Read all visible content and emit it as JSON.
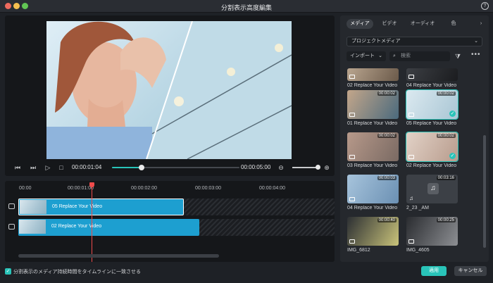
{
  "window": {
    "title": "分割表示高度編集"
  },
  "player": {
    "current_time": "00:00:01:04",
    "duration": "00:00:05:00",
    "progress": 0.23
  },
  "timeline": {
    "ticks": [
      "00:00",
      "00:00:01:00",
      "00:00:02:00",
      "00:00:03:00",
      "00:00:04:00"
    ],
    "clips": [
      {
        "label": "05 Replace Your Video",
        "selected": true
      },
      {
        "label": "02 Replace Your Video",
        "selected": false
      }
    ]
  },
  "media": {
    "tabs": [
      {
        "label": "メディア",
        "active": true
      },
      {
        "label": "ビデオ",
        "active": false
      },
      {
        "label": "オーディオ",
        "active": false
      },
      {
        "label": "色",
        "active": false
      }
    ],
    "source_select": "プロジェクトメディア",
    "import_label": "インポート",
    "search_placeholder": "検索",
    "items": [
      {
        "name": "02 Replace Your Video",
        "duration": "",
        "selected": false,
        "kind": "video"
      },
      {
        "name": "04 Replace Your Video",
        "duration": "",
        "selected": false,
        "kind": "video"
      },
      {
        "name": "01 Replace Your Video",
        "duration": "00:00:02",
        "selected": false,
        "kind": "video"
      },
      {
        "name": "05 Replace Your Video",
        "duration": "00:00:02",
        "selected": true,
        "kind": "video"
      },
      {
        "name": "03 Replace Your Video",
        "duration": "00:00:02",
        "selected": false,
        "kind": "video"
      },
      {
        "name": "02 Replace Your Video",
        "duration": "00:00:02",
        "selected": true,
        "kind": "video"
      },
      {
        "name": "04 Replace Your Video",
        "duration": "00:00:03",
        "selected": false,
        "kind": "video"
      },
      {
        "name": "2_23 _AM",
        "duration": "00:03:16",
        "selected": false,
        "kind": "audio"
      },
      {
        "name": "IMG_6812",
        "duration": "00:00:40",
        "selected": false,
        "kind": "video"
      },
      {
        "name": "IMG_4605",
        "duration": "00:00:25",
        "selected": false,
        "kind": "video"
      }
    ]
  },
  "footer": {
    "match_duration_label": "分割表示のメディア持続時間をタイムラインに一致させる",
    "apply_label": "適用",
    "cancel_label": "キャンセル"
  },
  "colors": {
    "accent": "#29c4b9",
    "clip": "#1d9fd0",
    "playhead": "#ef4b4b"
  }
}
